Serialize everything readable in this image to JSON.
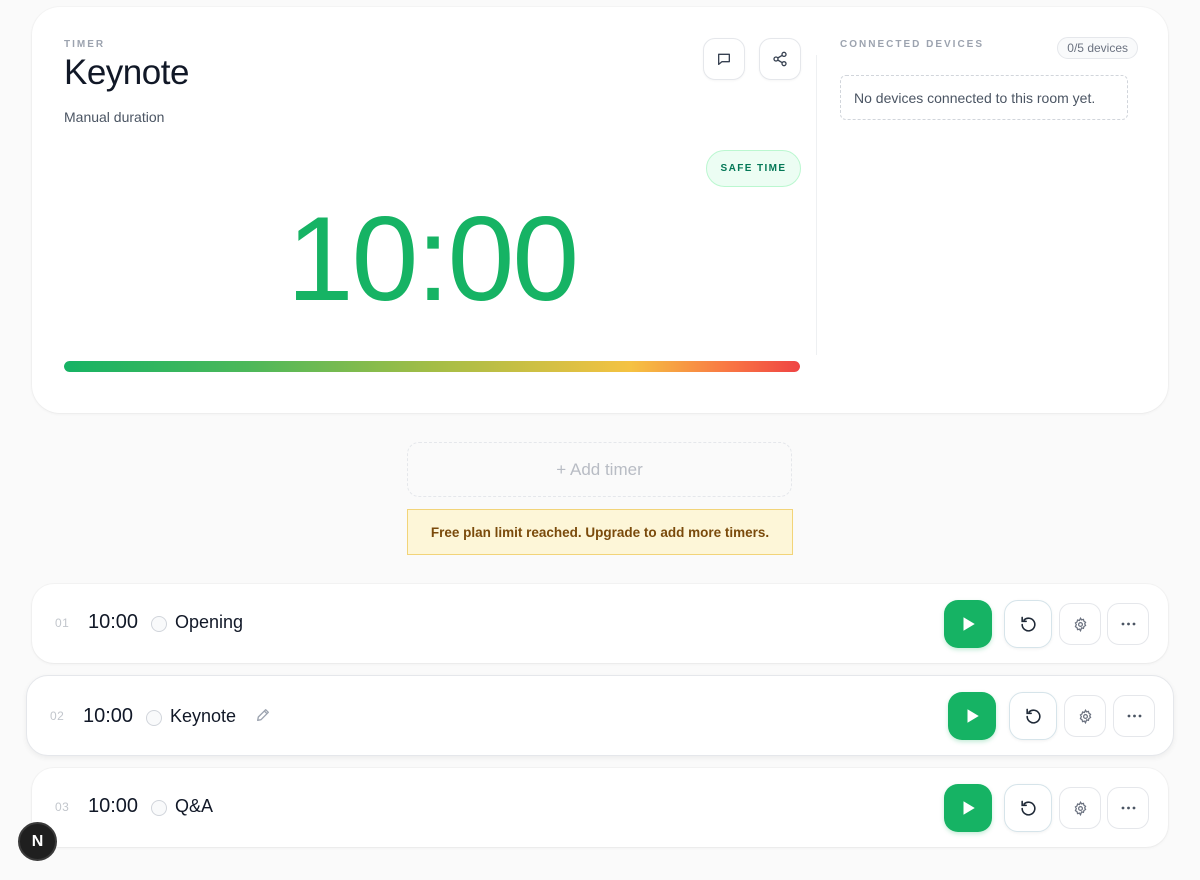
{
  "timer": {
    "eyebrow": "TIMER",
    "title": "Keynote",
    "subtitle": "Manual duration",
    "status_badge": "SAFE TIME",
    "display": "10:00",
    "progress_fraction": 1.0
  },
  "actions": {
    "chat_icon": "chat-bubble-icon",
    "share_icon": "share-icon"
  },
  "devices": {
    "eyebrow": "CONNECTED DEVICES",
    "count": "0/5 devices",
    "empty_message": "No devices connected to this room yet."
  },
  "add_timer_label": "+ Add timer",
  "limit_notice": "Free plan limit reached. Upgrade to add more timers.",
  "timers": [
    {
      "num": "01",
      "time": "10:00",
      "name": "Opening"
    },
    {
      "num": "02",
      "time": "10:00",
      "name": "Keynote"
    },
    {
      "num": "03",
      "time": "10:00",
      "name": "Q&A"
    }
  ],
  "badge": "N",
  "colors": {
    "accent": "#16b364",
    "notice_bg": "#fdf6d8",
    "notice_text": "#7a4a0b"
  }
}
